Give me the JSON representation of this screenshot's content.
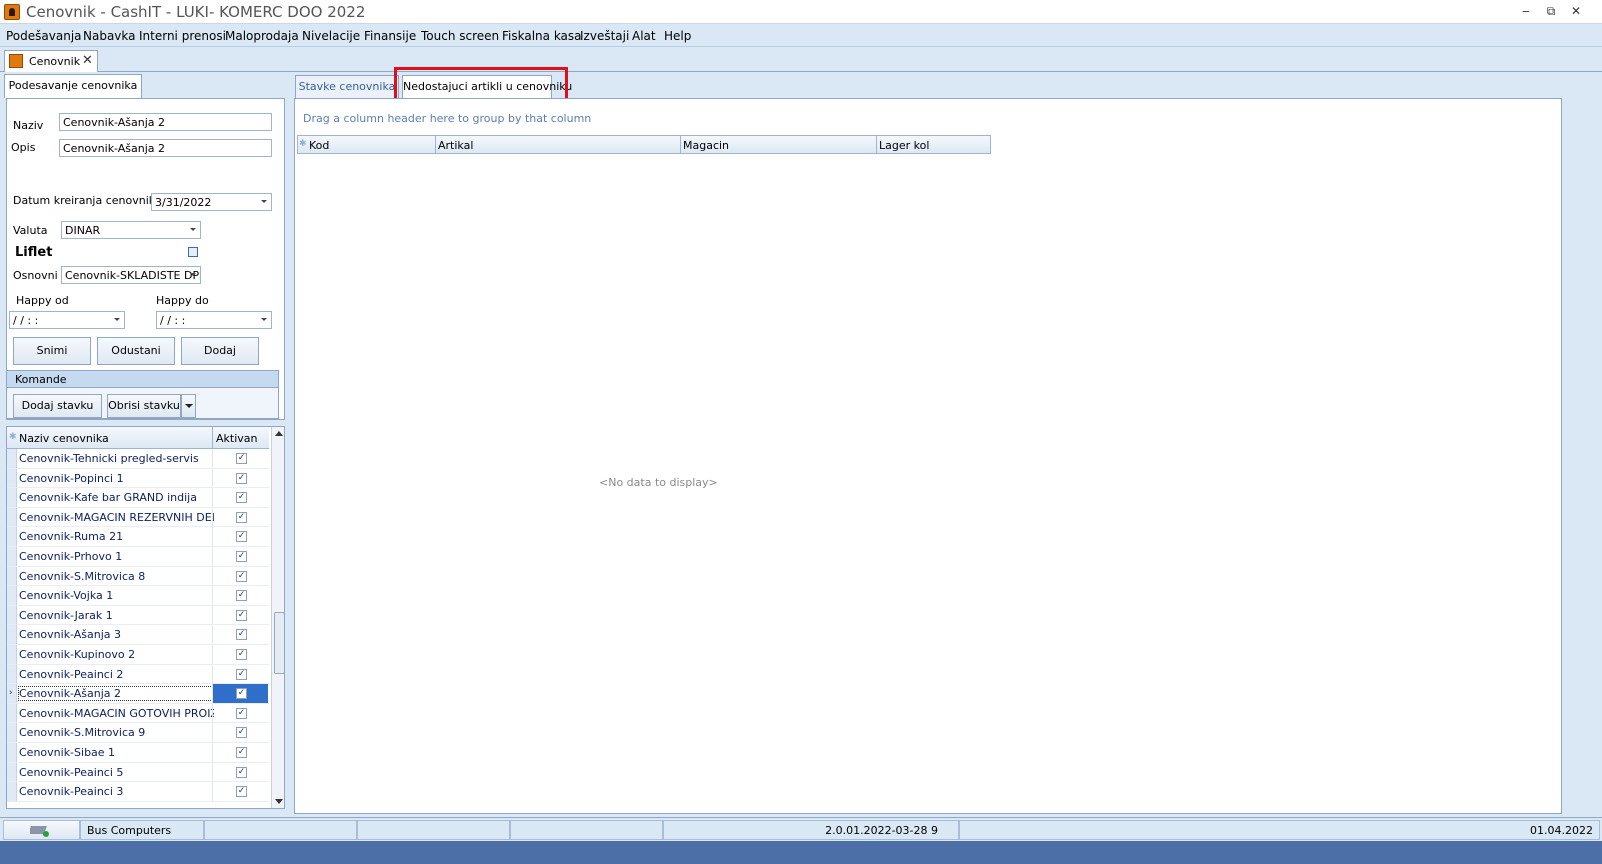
{
  "window": {
    "title": "Cenovnik - CashIT - LUKI- KOMERC DOO 2022",
    "min": "‒",
    "restore": "⧉",
    "close": "✕"
  },
  "menu": [
    "Podešavanja",
    "Nabavka",
    "Interni prenosi",
    "Maloprodaja",
    "Nivelacije",
    "Finansije",
    "Touch screen",
    "Fiskalna kasa",
    "Izveštaji",
    "Alat",
    "Help"
  ],
  "doc_tab": {
    "label": "Cenovnik",
    "close": "✕"
  },
  "left": {
    "tab": "Podesavanje cenovnika",
    "naziv_label": "Naziv",
    "naziv_value": "Cenovnik-Ašanja 2",
    "opis_label": "Opis",
    "opis_value": "Cenovnik-Ašanja 2",
    "datum_label": "Datum kreiranja cenovnika",
    "datum_value": "3/31/2022",
    "valuta_label": "Valuta",
    "valuta_value": "DINAR",
    "liflet_label": "Liflet",
    "osnovni_label": "Osnovni",
    "osnovni_value": "Cenovnik-SKLADISTE DPS",
    "happy_od_label": "Happy od",
    "happy_od_value": "/ /      : :",
    "happy_do_label": "Happy do",
    "happy_do_value": "/ /      : :",
    "snimi": "Snimi",
    "odustani": "Odustani",
    "dodaj": "Dodaj",
    "komande": "Komande",
    "dodaj_stavku": "Dodaj stavku",
    "obrisi_stavku": "Obrisi stavku"
  },
  "grid": {
    "col_naziv": "Naziv cenovnika",
    "col_aktivan": "Aktivan",
    "check": "✓",
    "rows": [
      {
        "name": "Cenovnik-Tehnicki pregled-servis",
        "active": true
      },
      {
        "name": "Cenovnik-Popinci 1",
        "active": true
      },
      {
        "name": "Cenovnik-Kafe bar GRAND indija",
        "active": true
      },
      {
        "name": "Cenovnik-MAGACIN REZERVNIH DELOVA",
        "active": true
      },
      {
        "name": "Cenovnik-Ruma 21",
        "active": true
      },
      {
        "name": "Cenovnik-Prhovo 1",
        "active": true
      },
      {
        "name": "Cenovnik-S.Mitrovica 8",
        "active": true
      },
      {
        "name": "Cenovnik-Vojka 1",
        "active": true
      },
      {
        "name": "Cenovnik-Jarak 1",
        "active": true
      },
      {
        "name": "Cenovnik-Ašanja 3",
        "active": true
      },
      {
        "name": "Cenovnik-Kupinovo 2",
        "active": true
      },
      {
        "name": "Cenovnik-Peainci 2",
        "active": true
      },
      {
        "name": "Cenovnik-Ašanja 2",
        "active": true,
        "selected": true
      },
      {
        "name": "Cenovnik-MAGACIN GOTOVIH PROIZVODA",
        "active": true
      },
      {
        "name": "Cenovnik-S.Mitrovica 9",
        "active": true
      },
      {
        "name": "Cenovnik-Sibae 1",
        "active": true
      },
      {
        "name": "Cenovnik-Peainci 5",
        "active": true
      },
      {
        "name": "Cenovnik-Peainci 3",
        "active": true
      }
    ]
  },
  "right": {
    "tab1": "Stavke cenovnika",
    "tab2": "Nedostajuci artikli u cenovniku",
    "group_hint": "Drag a column header here to group by that column",
    "columns": [
      "Kod",
      "Artikal",
      "Magacin",
      "Lager kol"
    ],
    "no_data": "<No data to display>"
  },
  "status": {
    "company": "Bus Computers",
    "version": "2.0.01.2022-03-28 9",
    "date": "01.04.2022"
  },
  "colors": {
    "highlight": "#e0101a",
    "selected": "#2f6fc9",
    "panel_bg": "#dae8f5"
  }
}
